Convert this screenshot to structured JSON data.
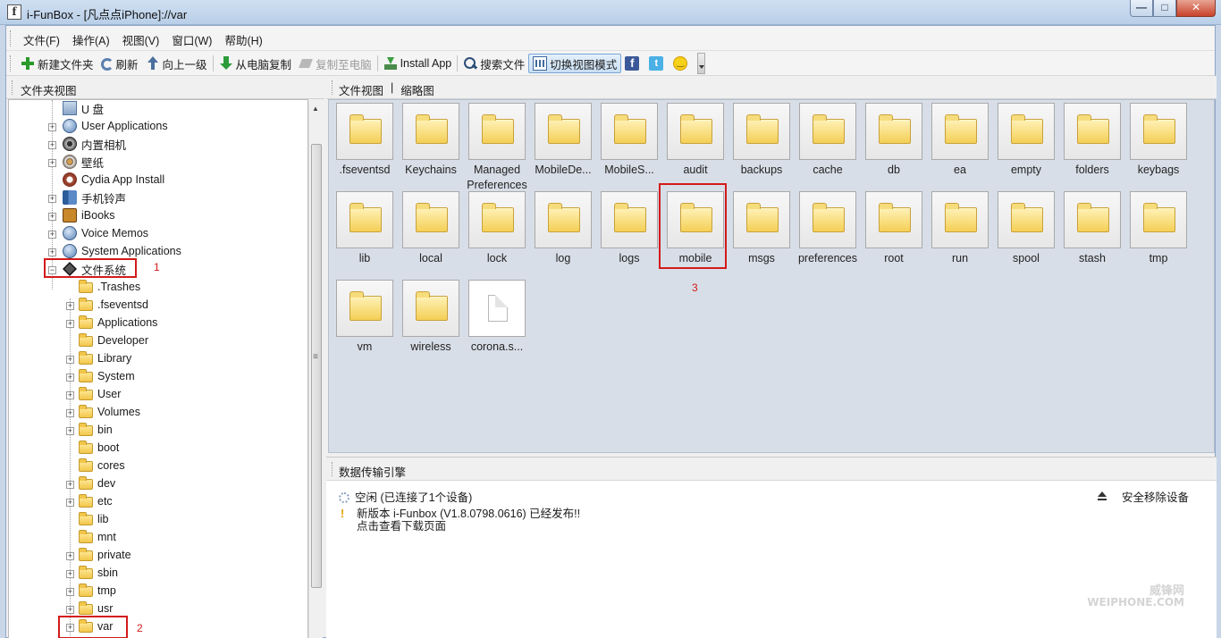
{
  "window": {
    "title": "i-FunBox - [凡点点iPhone]://var",
    "app_icon_letter": "f"
  },
  "menu": [
    "文件(F)",
    "操作(A)",
    "视图(V)",
    "窗口(W)",
    "帮助(H)"
  ],
  "toolbar": {
    "new_folder": "新建文件夹",
    "refresh": "刷新",
    "up": "向上一级",
    "copy_from_pc": "从电脑复制",
    "copy_to_pc": "复制至电脑",
    "install_app": "Install App",
    "search": "搜索文件",
    "switch_view": "切换视图模式"
  },
  "left_panel": {
    "header": "文件夹视图"
  },
  "tree": {
    "u_disk": "U 盘",
    "user_apps": "User Applications",
    "camera": "内置相机",
    "wallpaper": "壁纸",
    "cydia": "Cydia App Install",
    "ringtones": "手机铃声",
    "ibooks": "iBooks",
    "voice_memos": "Voice Memos",
    "system_apps": "System Applications",
    "filesystem": "文件系统",
    "children": [
      ".Trashes",
      ".fseventsd",
      "Applications",
      "Developer",
      "Library",
      "System",
      "User",
      "Volumes",
      "bin",
      "boot",
      "cores",
      "dev",
      "etc",
      "lib",
      "mnt",
      "private",
      "sbin",
      "tmp",
      "usr",
      "var"
    ]
  },
  "right_panel": {
    "tab_files": "文件视图",
    "tab_sep": "|",
    "tab_thumbs": "缩略图"
  },
  "grid_items": [
    ".fseventsd",
    "Keychains",
    "Managed Preferences",
    "MobileDe...",
    "MobileS...",
    "audit",
    "backups",
    "cache",
    "db",
    "ea",
    "empty",
    "folders",
    "keybags",
    "lib",
    "local",
    "lock",
    "log",
    "logs",
    "mobile",
    "msgs",
    "preferences",
    "root",
    "run",
    "spool",
    "stash",
    "tmp",
    "vm",
    "wireless",
    "corona.s..."
  ],
  "annotations": {
    "one": "1",
    "two": "2",
    "three": "3"
  },
  "transfer": {
    "header": "数据传输引擎",
    "status": "空闲 (已连接了1个设备)",
    "update_line1": "新版本 i-Funbox (V1.8.0798.0616) 已经发布!!",
    "update_line2": "点击查看下载页面",
    "safe_remove": "安全移除设备"
  },
  "watermark": {
    "line1": "威锋网",
    "line2": "WEIPHONE.COM"
  },
  "colors": {
    "highlight": "#d21a1a",
    "folder": "#f4cf55",
    "grid_bg": "#d8dee7"
  }
}
